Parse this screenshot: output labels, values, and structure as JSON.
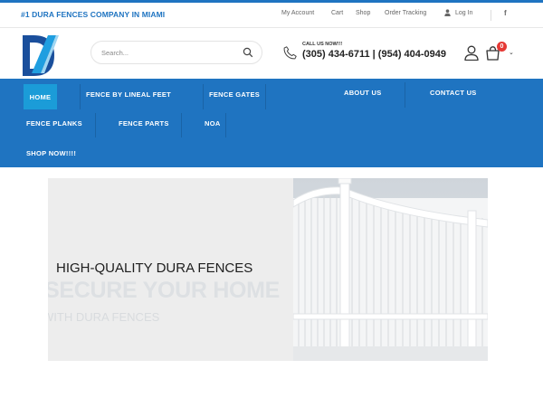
{
  "topbar": {
    "tagline": "#1 DURA FENCES COMPANY IN MIAMI",
    "links": [
      "My Account",
      "Cart",
      "Shop",
      "Order Tracking"
    ],
    "login_label": "Log In",
    "social_icon": "facebook-icon",
    "social_glyph": "f"
  },
  "header": {
    "logo_icon": "dura-fences-logo",
    "search": {
      "placeholder": "Search..."
    },
    "call_label": "CALL US NOW!!!",
    "phones": "(305) 434-6711 | (954) 404-0949",
    "cart_count": "0"
  },
  "nav": {
    "home": "HOME",
    "fence_by_lineal_feet": "FENCE BY LINEAL FEET",
    "fence_gates": "FENCE GATES",
    "about_us": "ABOUT US",
    "contact_us": "CONTACT US",
    "fence_planks": "FENCE PLANKS",
    "fence_parts": "FENCE PARTS",
    "noa": "NOA",
    "shop_now": "SHOP NOW!!!!"
  },
  "hero": {
    "headline": "HIGH-QUALITY DURA FENCES",
    "subheadline": "SECURE YOUR HOME",
    "tagline": "WITH DURA FENCES"
  },
  "colors": {
    "brand_blue": "#1f74c1",
    "active_nav": "#1b9cd8",
    "cart_badge": "#e53935"
  }
}
